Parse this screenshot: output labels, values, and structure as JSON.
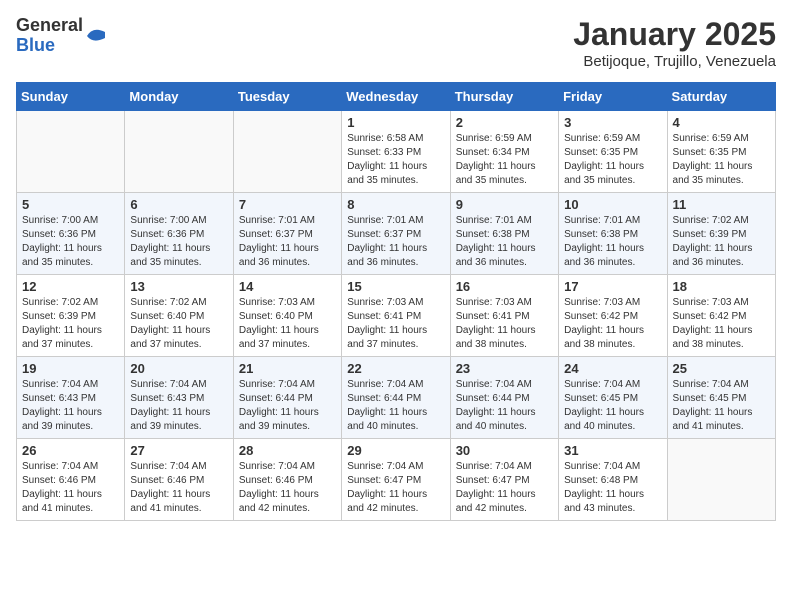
{
  "header": {
    "logo_general": "General",
    "logo_blue": "Blue",
    "month_title": "January 2025",
    "location": "Betijoque, Trujillo, Venezuela"
  },
  "weekdays": [
    "Sunday",
    "Monday",
    "Tuesday",
    "Wednesday",
    "Thursday",
    "Friday",
    "Saturday"
  ],
  "weeks": [
    [
      {
        "day": "",
        "empty": true
      },
      {
        "day": "",
        "empty": true
      },
      {
        "day": "",
        "empty": true
      },
      {
        "day": "1",
        "sunrise": "6:58 AM",
        "sunset": "6:33 PM",
        "daylight": "11 hours and 35 minutes."
      },
      {
        "day": "2",
        "sunrise": "6:59 AM",
        "sunset": "6:34 PM",
        "daylight": "11 hours and 35 minutes."
      },
      {
        "day": "3",
        "sunrise": "6:59 AM",
        "sunset": "6:35 PM",
        "daylight": "11 hours and 35 minutes."
      },
      {
        "day": "4",
        "sunrise": "6:59 AM",
        "sunset": "6:35 PM",
        "daylight": "11 hours and 35 minutes."
      }
    ],
    [
      {
        "day": "5",
        "sunrise": "7:00 AM",
        "sunset": "6:36 PM",
        "daylight": "11 hours and 35 minutes."
      },
      {
        "day": "6",
        "sunrise": "7:00 AM",
        "sunset": "6:36 PM",
        "daylight": "11 hours and 35 minutes."
      },
      {
        "day": "7",
        "sunrise": "7:01 AM",
        "sunset": "6:37 PM",
        "daylight": "11 hours and 36 minutes."
      },
      {
        "day": "8",
        "sunrise": "7:01 AM",
        "sunset": "6:37 PM",
        "daylight": "11 hours and 36 minutes."
      },
      {
        "day": "9",
        "sunrise": "7:01 AM",
        "sunset": "6:38 PM",
        "daylight": "11 hours and 36 minutes."
      },
      {
        "day": "10",
        "sunrise": "7:01 AM",
        "sunset": "6:38 PM",
        "daylight": "11 hours and 36 minutes."
      },
      {
        "day": "11",
        "sunrise": "7:02 AM",
        "sunset": "6:39 PM",
        "daylight": "11 hours and 36 minutes."
      }
    ],
    [
      {
        "day": "12",
        "sunrise": "7:02 AM",
        "sunset": "6:39 PM",
        "daylight": "11 hours and 37 minutes."
      },
      {
        "day": "13",
        "sunrise": "7:02 AM",
        "sunset": "6:40 PM",
        "daylight": "11 hours and 37 minutes."
      },
      {
        "day": "14",
        "sunrise": "7:03 AM",
        "sunset": "6:40 PM",
        "daylight": "11 hours and 37 minutes."
      },
      {
        "day": "15",
        "sunrise": "7:03 AM",
        "sunset": "6:41 PM",
        "daylight": "11 hours and 37 minutes."
      },
      {
        "day": "16",
        "sunrise": "7:03 AM",
        "sunset": "6:41 PM",
        "daylight": "11 hours and 38 minutes."
      },
      {
        "day": "17",
        "sunrise": "7:03 AM",
        "sunset": "6:42 PM",
        "daylight": "11 hours and 38 minutes."
      },
      {
        "day": "18",
        "sunrise": "7:03 AM",
        "sunset": "6:42 PM",
        "daylight": "11 hours and 38 minutes."
      }
    ],
    [
      {
        "day": "19",
        "sunrise": "7:04 AM",
        "sunset": "6:43 PM",
        "daylight": "11 hours and 39 minutes."
      },
      {
        "day": "20",
        "sunrise": "7:04 AM",
        "sunset": "6:43 PM",
        "daylight": "11 hours and 39 minutes."
      },
      {
        "day": "21",
        "sunrise": "7:04 AM",
        "sunset": "6:44 PM",
        "daylight": "11 hours and 39 minutes."
      },
      {
        "day": "22",
        "sunrise": "7:04 AM",
        "sunset": "6:44 PM",
        "daylight": "11 hours and 40 minutes."
      },
      {
        "day": "23",
        "sunrise": "7:04 AM",
        "sunset": "6:44 PM",
        "daylight": "11 hours and 40 minutes."
      },
      {
        "day": "24",
        "sunrise": "7:04 AM",
        "sunset": "6:45 PM",
        "daylight": "11 hours and 40 minutes."
      },
      {
        "day": "25",
        "sunrise": "7:04 AM",
        "sunset": "6:45 PM",
        "daylight": "11 hours and 41 minutes."
      }
    ],
    [
      {
        "day": "26",
        "sunrise": "7:04 AM",
        "sunset": "6:46 PM",
        "daylight": "11 hours and 41 minutes."
      },
      {
        "day": "27",
        "sunrise": "7:04 AM",
        "sunset": "6:46 PM",
        "daylight": "11 hours and 41 minutes."
      },
      {
        "day": "28",
        "sunrise": "7:04 AM",
        "sunset": "6:46 PM",
        "daylight": "11 hours and 42 minutes."
      },
      {
        "day": "29",
        "sunrise": "7:04 AM",
        "sunset": "6:47 PM",
        "daylight": "11 hours and 42 minutes."
      },
      {
        "day": "30",
        "sunrise": "7:04 AM",
        "sunset": "6:47 PM",
        "daylight": "11 hours and 42 minutes."
      },
      {
        "day": "31",
        "sunrise": "7:04 AM",
        "sunset": "6:48 PM",
        "daylight": "11 hours and 43 minutes."
      },
      {
        "day": "",
        "empty": true
      }
    ]
  ],
  "labels": {
    "sunrise": "Sunrise:",
    "sunset": "Sunset:",
    "daylight": "Daylight:"
  }
}
